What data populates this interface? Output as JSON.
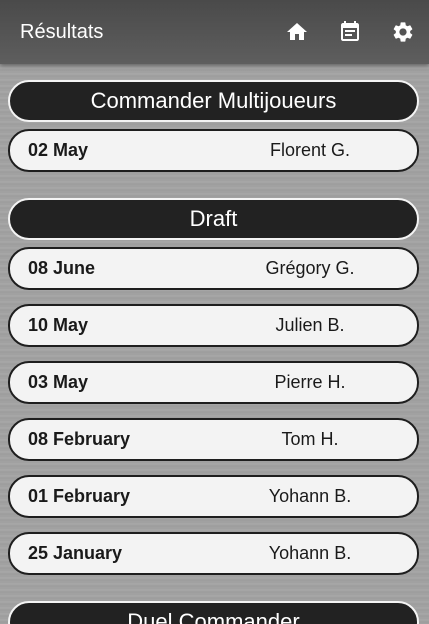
{
  "appbar": {
    "title": "Résultats",
    "actions": [
      {
        "icon": "home-icon"
      },
      {
        "icon": "calendar-icon"
      },
      {
        "icon": "gear-icon"
      }
    ]
  },
  "sections": [
    {
      "title": "Commander Multijoueurs",
      "rows": [
        {
          "date": "02 May",
          "name": "Florent G."
        }
      ]
    },
    {
      "title": "Draft",
      "rows": [
        {
          "date": "08 June",
          "name": "Grégory G."
        },
        {
          "date": "10 May",
          "name": "Julien B."
        },
        {
          "date": "03 May",
          "name": "Pierre H."
        },
        {
          "date": "08 February",
          "name": "Tom H."
        },
        {
          "date": "01 February",
          "name": "Yohann B."
        },
        {
          "date": "25 January",
          "name": "Yohann B."
        }
      ]
    },
    {
      "title": "Duel Commander",
      "rows": []
    }
  ],
  "colors": {
    "appbar": "#555555",
    "header_pill": "#222222",
    "row_pill": "#f3f3f3",
    "background": "#a2a2a2"
  }
}
